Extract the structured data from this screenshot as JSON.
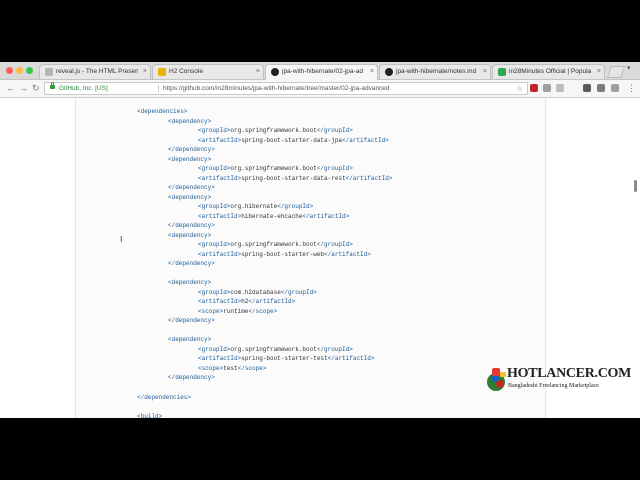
{
  "tabs": [
    {
      "title": "reveal.js - The HTML Presenta",
      "favicon_color": "#b5b5b5",
      "active": false
    },
    {
      "title": "H2 Console",
      "favicon_color": "#e8b400",
      "active": false
    },
    {
      "title": "jpa-with-hibernate/02-jpa-ad",
      "favicon_color": "#222222",
      "active": true
    },
    {
      "title": "jpa-with-hibernate/notes.md a",
      "favicon_color": "#222222",
      "active": false
    },
    {
      "title": "in28Minutes Official | Popula",
      "favicon_color": "#2faa4a",
      "active": false
    }
  ],
  "tab_close_glyph": "×",
  "toolbar": {
    "back_glyph": "←",
    "forward_glyph": "→",
    "reload_glyph": "↻",
    "ev_label": "GitHub, Inc. [US]",
    "url": "https://github.com/in28minutes/jpa-with-hibernate/tree/master/02-jpa-advanced",
    "star_glyph": "☆",
    "menu_glyph": "⋮"
  },
  "code_lines": [
    [
      {
        "t": "tag",
        "v": "<dependencies>"
      }
    ],
    [
      {
        "t": "tag",
        "v": "<dependency>"
      }
    ],
    [
      {
        "t": "tag",
        "v": "<groupId>"
      },
      {
        "t": "txt",
        "v": "org.springframework.boot"
      },
      {
        "t": "tag",
        "v": "</groupId>"
      }
    ],
    [
      {
        "t": "tag",
        "v": "<artifactId>"
      },
      {
        "t": "txt",
        "v": "spring-boot-starter-data-jpa"
      },
      {
        "t": "tag",
        "v": "</artifactId>"
      }
    ],
    [
      {
        "t": "tag",
        "v": "</dependency>"
      }
    ],
    [
      {
        "t": "tag",
        "v": "<dependency>"
      }
    ],
    [
      {
        "t": "tag",
        "v": "<groupId>"
      },
      {
        "t": "txt",
        "v": "org.springframework.boot"
      },
      {
        "t": "tag",
        "v": "</groupId>"
      }
    ],
    [
      {
        "t": "tag",
        "v": "<artifactId>"
      },
      {
        "t": "txt",
        "v": "spring-boot-starter-data-rest"
      },
      {
        "t": "tag",
        "v": "</artifactId>"
      }
    ],
    [
      {
        "t": "tag",
        "v": "</dependency>"
      }
    ],
    [
      {
        "t": "tag",
        "v": "<dependency>"
      }
    ],
    [
      {
        "t": "tag",
        "v": "<groupId>"
      },
      {
        "t": "txt",
        "v": "org.hibernate"
      },
      {
        "t": "tag",
        "v": "</groupId>"
      }
    ],
    [
      {
        "t": "tag",
        "v": "<artifactId>"
      },
      {
        "t": "txt",
        "v": "hibernate-ehcache"
      },
      {
        "t": "tag",
        "v": "</artifactId>"
      }
    ],
    [
      {
        "t": "tag",
        "v": "</dependency>"
      }
    ],
    [
      {
        "t": "tag",
        "v": "<dependency>"
      }
    ],
    [
      {
        "t": "tag",
        "v": "<groupId>"
      },
      {
        "t": "txt",
        "v": "org.springframework.boot"
      },
      {
        "t": "tag",
        "v": "</groupId>"
      }
    ],
    [
      {
        "t": "tag",
        "v": "<artifactId>"
      },
      {
        "t": "txt",
        "v": "spring-boot-starter-web"
      },
      {
        "t": "tag",
        "v": "</artifactId>"
      }
    ],
    [
      {
        "t": "tag",
        "v": "</dependency>"
      }
    ],
    [
      {
        "t": "tag",
        "v": "<dependency>"
      }
    ],
    [
      {
        "t": "tag",
        "v": "<groupId>"
      },
      {
        "t": "txt",
        "v": "com.h2database"
      },
      {
        "t": "tag",
        "v": "</groupId>"
      }
    ],
    [
      {
        "t": "tag",
        "v": "<artifactId>"
      },
      {
        "t": "txt",
        "v": "h2"
      },
      {
        "t": "tag",
        "v": "</artifactId>"
      }
    ],
    [
      {
        "t": "tag",
        "v": "<scope>"
      },
      {
        "t": "txt",
        "v": "runtime"
      },
      {
        "t": "tag",
        "v": "</scope>"
      }
    ],
    [
      {
        "t": "tag",
        "v": "</dependency>"
      }
    ],
    [
      {
        "t": "tag",
        "v": "<dependency>"
      }
    ],
    [
      {
        "t": "tag",
        "v": "<groupId>"
      },
      {
        "t": "txt",
        "v": "org.springframework.boot"
      },
      {
        "t": "tag",
        "v": "</groupId>"
      }
    ],
    [
      {
        "t": "tag",
        "v": "<artifactId>"
      },
      {
        "t": "txt",
        "v": "spring-boot-starter-test"
      },
      {
        "t": "tag",
        "v": "</artifactId>"
      }
    ],
    [
      {
        "t": "tag",
        "v": "<scope>"
      },
      {
        "t": "txt",
        "v": "test"
      },
      {
        "t": "tag",
        "v": "</scope>"
      }
    ],
    [
      {
        "t": "tag",
        "v": "</dependency>"
      }
    ],
    [
      {
        "t": "tag",
        "v": "</dependencies>"
      }
    ],
    [
      {
        "t": "tag",
        "v": "<build>"
      }
    ]
  ],
  "cursor_glyph": "I",
  "watermark": {
    "name": "HOTLANCER.COM",
    "tagline": "Bangladeshi Freelancing Marketplace"
  },
  "colors": {
    "xml_tag": "#1c5a96",
    "ev_green": "#2a8a3a",
    "code_bg": "#fbfbfb"
  },
  "icons": [
    "github-icon",
    "lock-icon",
    "star-icon",
    "extension-icon",
    "menu-icon",
    "hotlancer-logo-icon"
  ]
}
